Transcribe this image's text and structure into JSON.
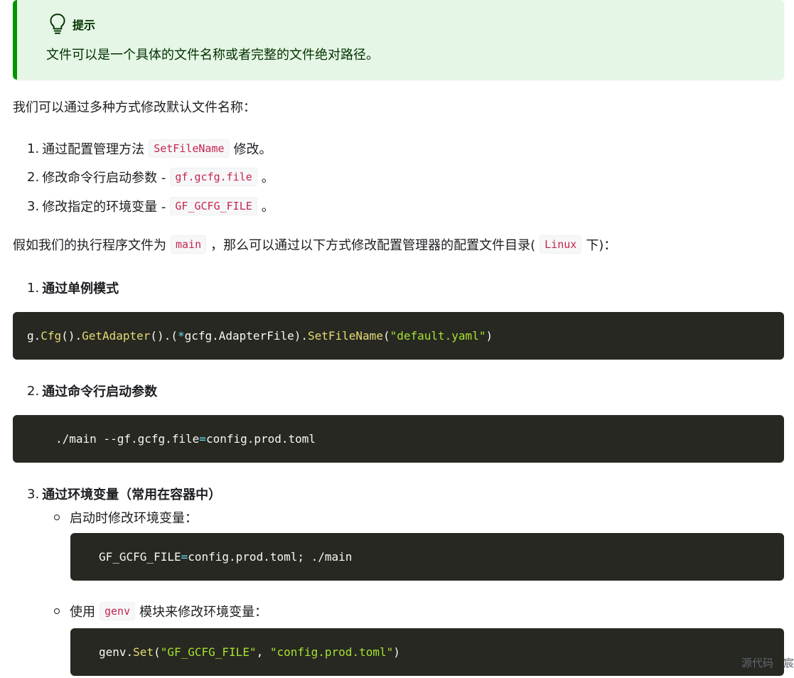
{
  "tip": {
    "title": "提示",
    "text": "文件可以是一个具体的文件名称或者完整的文件绝对路径。"
  },
  "intro": "我们可以通过多种方式修改默认文件名称：",
  "methods": [
    {
      "num": "1.",
      "before": "通过配置管理方法",
      "code": "SetFileName",
      "after": "修改。"
    },
    {
      "num": "2.",
      "before": "修改命令行启动参数 -",
      "code": "gf.gcfg.file",
      "after": "。"
    },
    {
      "num": "3.",
      "before": "修改指定的环境变量 -",
      "code": "GF_GCFG_FILE",
      "after": "。"
    }
  ],
  "para2": {
    "before": "假如我们的执行程序文件为",
    "code1": "main",
    "middle": "，那么可以通过以下方式修改配置管理器的配置文件目录(",
    "code2": "Linux",
    "after": "下)："
  },
  "steps": [
    {
      "num": "1.",
      "label": "通过单例模式"
    },
    {
      "num": "2.",
      "label": "通过命令行启动参数"
    },
    {
      "num": "3.",
      "label": "通过环境变量（常用在容器中）"
    }
  ],
  "code1": {
    "g": "g",
    "dot1": ".",
    "cfg": "Cfg",
    "p1": "().",
    "getadapter": "GetAdapter",
    "p2": "().(",
    "star": "*",
    "type": "gcfg.AdapterFile",
    "p3": ").",
    "setfilename": "SetFileName",
    "p4": "(",
    "str": "\"default.yaml\"",
    "p5": ")"
  },
  "code2": {
    "a": "./main --gf.gcfg.file",
    "eq": "=",
    "b": "config.prod.toml"
  },
  "substeps": [
    {
      "label": "启动时修改环境变量："
    },
    {
      "before": "使用",
      "code": "genv",
      "after": "模块来修改环境变量："
    }
  ],
  "code3": {
    "a": "GF_GCFG_FILE",
    "eq": "=",
    "b": "config.prod.toml; ./main"
  },
  "code4": {
    "genv": "genv",
    "dot": ".",
    "set": "Set",
    "p1": "(",
    "s1": "\"GF_GCFG_FILE\"",
    "comma": ", ",
    "s2": "\"config.prod.toml\"",
    "p2": ")"
  },
  "footer": {
    "source": "源代码",
    "more": "宸"
  }
}
